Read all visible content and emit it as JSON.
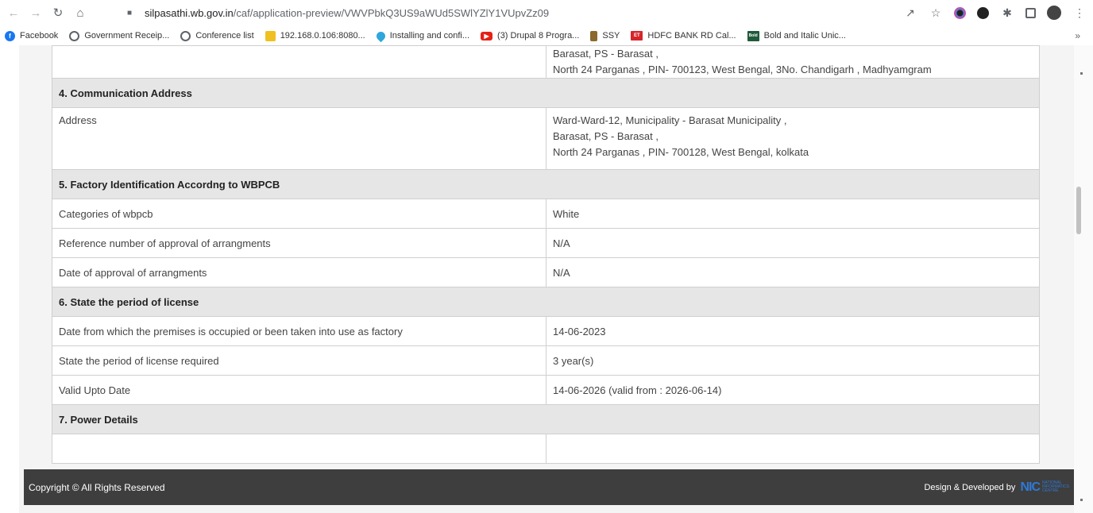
{
  "browser": {
    "url_host": "silpasathi.wb.gov.in",
    "url_path": "/caf/application-preview/VWVPbkQ3US9aWUd5SWlYZlY1VUpvZz09",
    "icons": [
      "back-icon",
      "forward-icon",
      "reload-icon",
      "home-icon",
      "lock-icon",
      "share-icon",
      "star-icon",
      "extension-icon",
      "puzzle-icon",
      "sidebar-icon",
      "profile-avatar",
      "menu-icon"
    ]
  },
  "bookmarks": {
    "items": [
      {
        "label": "Facebook",
        "icon": "facebook-icon"
      },
      {
        "label": "Government Receip...",
        "icon": "globe-icon"
      },
      {
        "label": "Conference list",
        "icon": "globe-icon"
      },
      {
        "label": "192.168.0.106:8080...",
        "icon": "pma-icon"
      },
      {
        "label": "Installing and confi...",
        "icon": "drupal-icon"
      },
      {
        "label": "(3) Drupal 8 Progra...",
        "icon": "youtube-icon"
      },
      {
        "label": "SSY",
        "icon": "emblem-icon"
      },
      {
        "label": "HDFC BANK RD Cal...",
        "icon": "et-icon"
      },
      {
        "label": "Bold and Italic Unic...",
        "icon": "bold-text-icon"
      }
    ],
    "more": "»"
  },
  "table": {
    "top_partial": {
      "line1": "Barasat, PS - Barasat ,",
      "line2": "North 24 Parganas , PIN- 700123, West Bengal, 3No. Chandigarh , Madhyamgram"
    },
    "sec4": {
      "title": "4. Communication Address",
      "address_label": "Address",
      "address_line1": "Ward-Ward-12, Municipality - Barasat Municipality ,",
      "address_line2": "Barasat, PS - Barasat ,",
      "address_line3": "North 24 Parganas , PIN- 700128, West Bengal, kolkata"
    },
    "sec5": {
      "title": "5. Factory Identification Accordng to WBPCB",
      "rows": [
        {
          "label": "Categories of wbpcb",
          "value": "White"
        },
        {
          "label": "Reference number of approval of arrangments",
          "value": "N/A"
        },
        {
          "label": "Date of approval of arrangments",
          "value": "N/A"
        }
      ]
    },
    "sec6": {
      "title": "6. State the period of license",
      "rows": [
        {
          "label": "Date from which the premises is occupied or been taken into use as factory",
          "value": "14-06-2023"
        },
        {
          "label": "State the period of license required",
          "value": "3 year(s)"
        },
        {
          "label": "Valid Upto Date",
          "value": "14-06-2026 (valid from : 2026-06-14)"
        }
      ]
    },
    "sec7": {
      "title": "7. Power Details"
    }
  },
  "footer": {
    "copyright": "Copyright © All Rights Reserved",
    "credit": "Design & Developed by",
    "logo_mark": "NIC",
    "logo_text": "NATIONAL INFORMATICS CENTRE"
  }
}
